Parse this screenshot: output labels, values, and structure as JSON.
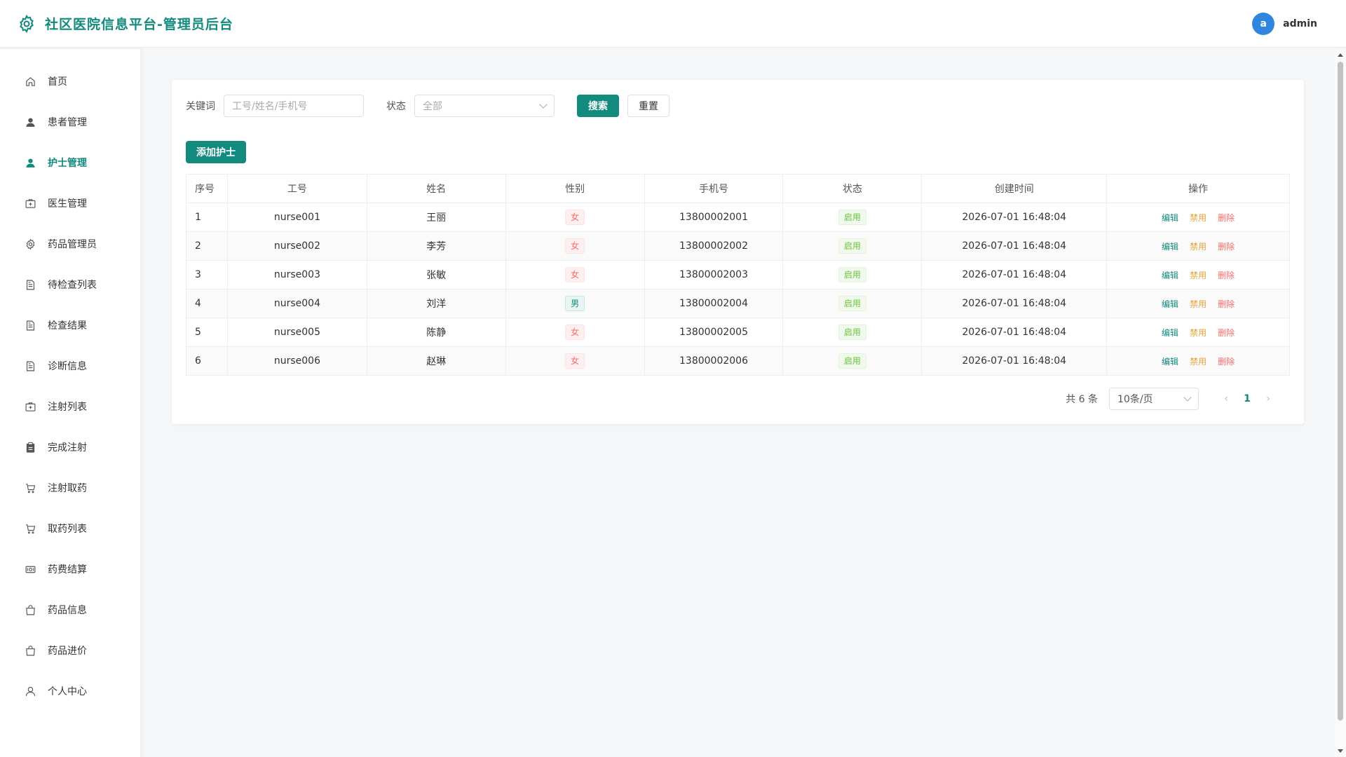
{
  "header": {
    "title": "社区医院信息平台-管理员后台",
    "user": {
      "avatar_letter": "a",
      "name": "admin"
    }
  },
  "sidebar": {
    "items": [
      {
        "label": "首页",
        "icon": "home-icon",
        "active": false
      },
      {
        "label": "患者管理",
        "icon": "user-filled-icon",
        "active": false
      },
      {
        "label": "护士管理",
        "icon": "user-filled-icon",
        "active": true
      },
      {
        "label": "医生管理",
        "icon": "first-aid-kit-icon",
        "active": false
      },
      {
        "label": "药品管理员",
        "icon": "gear-icon",
        "active": false
      },
      {
        "label": "待检查列表",
        "icon": "document-icon",
        "active": false
      },
      {
        "label": "检查结果",
        "icon": "document-icon",
        "active": false
      },
      {
        "label": "诊断信息",
        "icon": "document-icon",
        "active": false
      },
      {
        "label": "注射列表",
        "icon": "first-aid-kit-icon",
        "active": false
      },
      {
        "label": "完成注射",
        "icon": "clipboard-icon",
        "active": false
      },
      {
        "label": "注射取药",
        "icon": "cart-icon",
        "active": false
      },
      {
        "label": "取药列表",
        "icon": "cart-icon",
        "active": false
      },
      {
        "label": "药费结算",
        "icon": "money-icon",
        "active": false
      },
      {
        "label": "药品信息",
        "icon": "bag-icon",
        "active": false
      },
      {
        "label": "药品进价",
        "icon": "bag-icon",
        "active": false
      },
      {
        "label": "个人中心",
        "icon": "user-icon",
        "active": false
      }
    ]
  },
  "filters": {
    "keyword_label": "关键词",
    "keyword_placeholder": "工号/姓名/手机号",
    "status_label": "状态",
    "status_value": "全部",
    "search_label": "搜索",
    "reset_label": "重置"
  },
  "add_button": "添加护士",
  "table": {
    "columns": [
      "序号",
      "工号",
      "姓名",
      "性别",
      "手机号",
      "状态",
      "创建时间",
      "操作"
    ],
    "rows": [
      {
        "idx": "1",
        "id": "nurse001",
        "name": "王丽",
        "gender": "女",
        "phone": "13800002001",
        "status": "启用",
        "created": "2026-07-01 16:48:04"
      },
      {
        "idx": "2",
        "id": "nurse002",
        "name": "李芳",
        "gender": "女",
        "phone": "13800002002",
        "status": "启用",
        "created": "2026-07-01 16:48:04"
      },
      {
        "idx": "3",
        "id": "nurse003",
        "name": "张敏",
        "gender": "女",
        "phone": "13800002003",
        "status": "启用",
        "created": "2026-07-01 16:48:04"
      },
      {
        "idx": "4",
        "id": "nurse004",
        "name": "刘洋",
        "gender": "男",
        "phone": "13800002004",
        "status": "启用",
        "created": "2026-07-01 16:48:04"
      },
      {
        "idx": "5",
        "id": "nurse005",
        "name": "陈静",
        "gender": "女",
        "phone": "13800002005",
        "status": "启用",
        "created": "2026-07-01 16:48:04"
      },
      {
        "idx": "6",
        "id": "nurse006",
        "name": "赵琳",
        "gender": "女",
        "phone": "13800002006",
        "status": "启用",
        "created": "2026-07-01 16:48:04"
      }
    ],
    "actions": {
      "edit": "编辑",
      "disable": "禁用",
      "delete": "删除"
    }
  },
  "pagination": {
    "total_text": "共 6 条",
    "page_size": "10条/页",
    "current_page": "1"
  },
  "colors": {
    "primary": "#138a7e",
    "female_tag": "#f56c6c",
    "enabled_tag": "#67c23a",
    "disable_action": "#e6a23c",
    "delete_action": "#f56c6c"
  }
}
